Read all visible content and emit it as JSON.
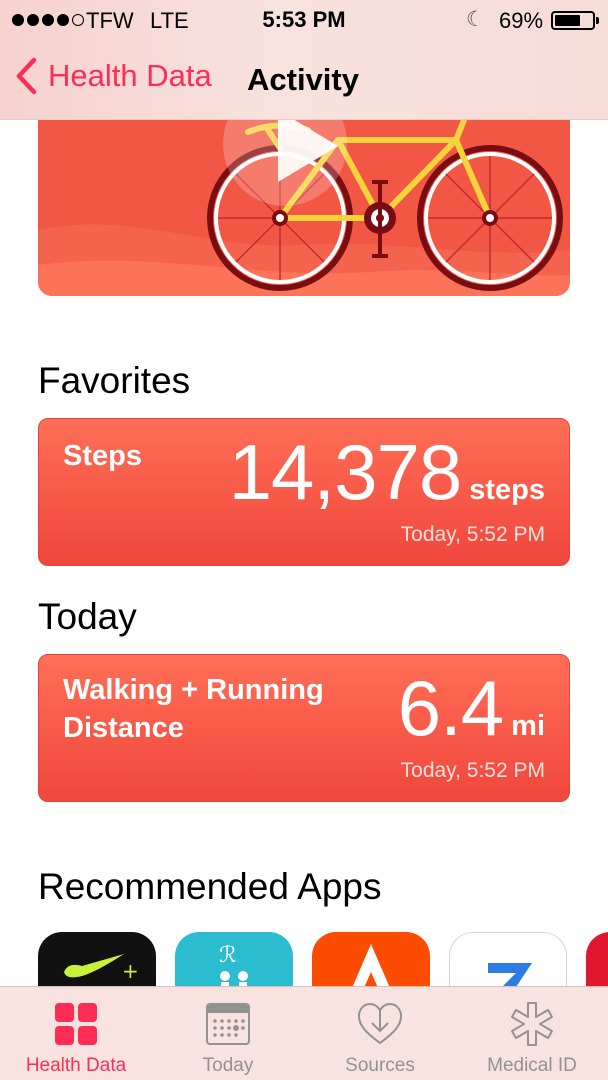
{
  "status_bar": {
    "carrier": "TFW",
    "network": "LTE",
    "time": "5:53 PM",
    "battery_percent": "69%",
    "battery_level": 0.69,
    "signal_bars": 4
  },
  "nav": {
    "back_label": "Health Data",
    "title": "Activity"
  },
  "hero": {
    "icons": [
      "play-icon",
      "bicycle-illustration"
    ]
  },
  "favorites": {
    "heading": "Favorites",
    "card": {
      "label": "Steps",
      "value": "14,378",
      "unit": "steps",
      "timestamp": "Today, 5:52 PM"
    }
  },
  "today": {
    "heading": "Today",
    "card": {
      "label_line1": "Walking + Running",
      "label_line2": "Distance",
      "value": "6.4",
      "unit": "mi",
      "timestamp": "Today, 5:52 PM"
    }
  },
  "recommended": {
    "heading": "Recommended Apps",
    "apps": [
      {
        "icon": "nike-app-icon",
        "color": "#111111"
      },
      {
        "icon": "runkeeper-app-icon",
        "color": "#2bbcd0"
      },
      {
        "icon": "strava-app-icon",
        "color": "#fc4c02"
      },
      {
        "icon": "lose-it-app-icon",
        "color": "#ffffff"
      },
      {
        "icon": "partial-app-icon",
        "color": "#e0172f"
      }
    ]
  },
  "tab_bar": {
    "tabs": [
      {
        "label": "Health Data",
        "icon": "health-data-icon",
        "active": true
      },
      {
        "label": "Today",
        "icon": "calendar-icon",
        "active": false
      },
      {
        "label": "Sources",
        "icon": "sources-icon",
        "active": false
      },
      {
        "label": "Medical ID",
        "icon": "medical-id-icon",
        "active": false
      }
    ]
  },
  "colors": {
    "accent": "#ff2d55",
    "card": "#f0463d",
    "hero": "#f25645"
  }
}
